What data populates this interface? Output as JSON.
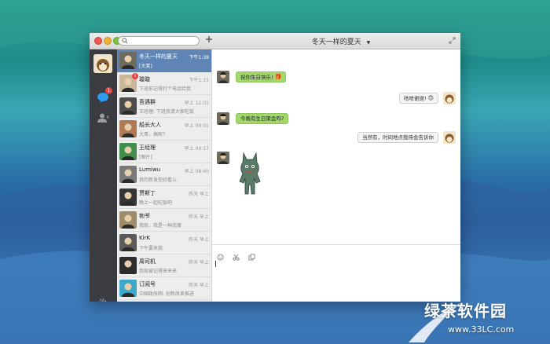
{
  "window": {
    "title": "冬天一样的夏天",
    "title_caret": "▼"
  },
  "search": {
    "placeholder": "",
    "value": ""
  },
  "sidebar": {
    "chat_badge": "1"
  },
  "conversations": [
    {
      "name": "冬天一样的夏天",
      "time": "下午1:38",
      "preview": "[大笑]",
      "active": true,
      "badge": ""
    },
    {
      "name": "璇璇",
      "time": "下午1:15",
      "preview": "下班前记得打个电话给我",
      "active": false,
      "badge": "1"
    },
    {
      "name": "吾遇群",
      "time": "早上 12:01",
      "preview": "王经理: 下班我请大家吃饭",
      "active": false,
      "badge": ""
    },
    {
      "name": "船长大人",
      "time": "早上 09:01",
      "preview": "大哥，搞呢？",
      "active": false,
      "badge": ""
    },
    {
      "name": "王经理",
      "time": "早上 09:17",
      "preview": "[图片]",
      "active": false,
      "badge": ""
    },
    {
      "name": "Lumiwu",
      "time": "早上 08:40",
      "preview": "我的新发型好看么",
      "active": false,
      "badge": ""
    },
    {
      "name": "贾斯丁",
      "time": "昨天 早上",
      "preview": "晚上一起吃饭吧",
      "active": false,
      "badge": ""
    },
    {
      "name": "勃爷",
      "time": "昨天 早上",
      "preview": "我就，我是一种态度",
      "active": false,
      "badge": ""
    },
    {
      "name": "KirK",
      "time": "昨天 早上",
      "preview": "下午要来我",
      "active": false,
      "badge": ""
    },
    {
      "name": "周司机",
      "time": "昨天 早上",
      "preview": "我就被记得来来来",
      "active": false,
      "badge": ""
    },
    {
      "name": "订阅号",
      "time": "昨天 早上",
      "preview": "中国政府网: 创新改革推进",
      "active": false,
      "badge": ""
    }
  ],
  "messages": [
    {
      "dir": "recv",
      "text": "祝你生日快乐!",
      "emoji": "🎁"
    },
    {
      "dir": "sent",
      "text": "哈哈谢谢!",
      "emoji": "😊"
    },
    {
      "dir": "recv",
      "text": "今晚有生日聚会吗?",
      "emoji": ""
    },
    {
      "dir": "sent",
      "text": "当然有，时间地点我待会告诉你",
      "emoji": ""
    }
  ],
  "watermark": {
    "text": "绿茶软件园",
    "url": "www.33LC.com"
  },
  "colors": {
    "active_row": "#5e85b5",
    "recv_bubble": "#a3d76c",
    "sidebar": "#3a3c41",
    "badge": "#e64340"
  }
}
